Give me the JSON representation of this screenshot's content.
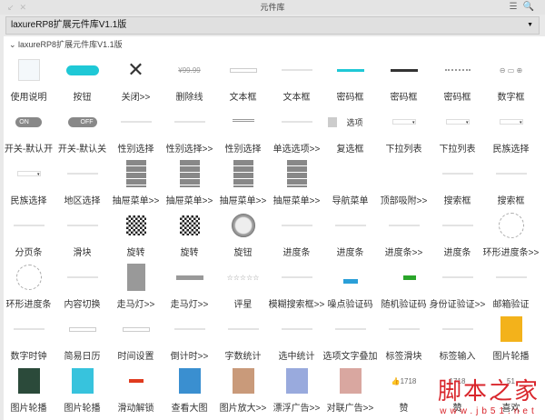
{
  "window": {
    "title": "元件库"
  },
  "library_select": {
    "value": "laxureRP8扩展元件库V1.1版"
  },
  "group": {
    "label": "laxureRP8扩展元件库V1.1版"
  },
  "colors": {
    "accent": "#1fc8d6",
    "green": "#2aa52a",
    "blue": "#2a9fd8",
    "watermark": "#d9262c"
  },
  "items": [
    {
      "label": "使用说明",
      "t": "doc"
    },
    {
      "label": "按钮",
      "t": "btn"
    },
    {
      "label": "关闭>>",
      "t": "x"
    },
    {
      "label": "删除线",
      "t": "price",
      "txt": "¥99.99"
    },
    {
      "label": "文本框",
      "t": "input"
    },
    {
      "label": "文本框",
      "t": "line"
    },
    {
      "label": "密码框",
      "t": "cyan"
    },
    {
      "label": "密码框",
      "t": "dark"
    },
    {
      "label": "密码框",
      "t": "dots"
    },
    {
      "label": "数字框",
      "t": "num"
    },
    {
      "label": "开关-默认开",
      "t": "on",
      "txt": "ON"
    },
    {
      "label": "开关-默认关",
      "t": "off",
      "txt": "OFF"
    },
    {
      "label": "性别选择",
      "t": "line"
    },
    {
      "label": "性别选择>>",
      "t": "line"
    },
    {
      "label": "性别选择",
      "t": "grid"
    },
    {
      "label": "单选选项>>",
      "t": "line"
    },
    {
      "label": "复选框",
      "t": "check",
      "txt": "选项"
    },
    {
      "label": "下拉列表",
      "t": "dd"
    },
    {
      "label": "下拉列表",
      "t": "dd"
    },
    {
      "label": "民族选择",
      "t": "dd"
    },
    {
      "label": "民族选择",
      "t": "dd"
    },
    {
      "label": "地区选择",
      "t": "line"
    },
    {
      "label": "抽屉菜单>>",
      "t": "drawer"
    },
    {
      "label": "抽屉菜单>>",
      "t": "drawer"
    },
    {
      "label": "抽屉菜单>>",
      "t": "drawer"
    },
    {
      "label": "抽屉菜单>>",
      "t": "drawer"
    },
    {
      "label": "导航菜单",
      "t": "none"
    },
    {
      "label": "顶部吸附>>",
      "t": "none"
    },
    {
      "label": "搜索框",
      "t": "line"
    },
    {
      "label": "搜索框",
      "t": "line"
    },
    {
      "label": "分页条",
      "t": "line"
    },
    {
      "label": "滑块",
      "t": "line"
    },
    {
      "label": "旋转",
      "t": "qr"
    },
    {
      "label": "旋转",
      "t": "qr"
    },
    {
      "label": "旋钮",
      "t": "knob"
    },
    {
      "label": "进度条",
      "t": "line"
    },
    {
      "label": "进度条",
      "t": "line"
    },
    {
      "label": "进度条>>",
      "t": "line"
    },
    {
      "label": "进度条",
      "t": "line"
    },
    {
      "label": "环形进度条>>",
      "t": "ring"
    },
    {
      "label": "环形进度条",
      "t": "ring"
    },
    {
      "label": "内容切换",
      "t": "line"
    },
    {
      "label": "走马灯>>",
      "t": "gray"
    },
    {
      "label": "走马灯>>",
      "t": "graybar"
    },
    {
      "label": "评星",
      "t": "stars",
      "txt": "☆☆☆☆☆"
    },
    {
      "label": "模糊搜索框>>",
      "t": "line"
    },
    {
      "label": "噪点验证码",
      "t": "blue"
    },
    {
      "label": "随机验证码",
      "t": "green"
    },
    {
      "label": "身份证验证>>",
      "t": "line"
    },
    {
      "label": "邮箱验证",
      "t": "line"
    },
    {
      "label": "数字时钟",
      "t": "line"
    },
    {
      "label": "简易日历",
      "t": "input"
    },
    {
      "label": "时间设置",
      "t": "input"
    },
    {
      "label": "倒计时>>",
      "t": "line"
    },
    {
      "label": "字数统计",
      "t": "line"
    },
    {
      "label": "选中统计",
      "t": "line"
    },
    {
      "label": "选项文字叠加",
      "t": "line"
    },
    {
      "label": "标签滑块",
      "t": "line"
    },
    {
      "label": "标签输入",
      "t": "line"
    },
    {
      "label": "图片轮播",
      "t": "pic",
      "c": "#f3b21b"
    },
    {
      "label": "图片轮播",
      "t": "pic",
      "c": "#2b4a3a"
    },
    {
      "label": "图片轮播",
      "t": "pic",
      "c": "#37c3dd"
    },
    {
      "label": "滑动解锁",
      "t": "red"
    },
    {
      "label": "查看大图",
      "t": "pic",
      "c": "#3a8fd0"
    },
    {
      "label": "图片放大>>",
      "t": "pic",
      "c": "#c99a7a"
    },
    {
      "label": "漂浮广告>>",
      "t": "pic",
      "c": "#9ad"
    },
    {
      "label": "对联广告>>",
      "t": "pic",
      "c": "#d9a7a0"
    },
    {
      "label": "赞",
      "t": "like",
      "txt": "👍1718"
    },
    {
      "label": "赞",
      "t": "like",
      "txt": "1718"
    },
    {
      "label": "喜欢",
      "t": "like",
      "txt": "51"
    }
  ],
  "watermark": {
    "title": "脚本之家",
    "url": "www.jb51.net"
  }
}
